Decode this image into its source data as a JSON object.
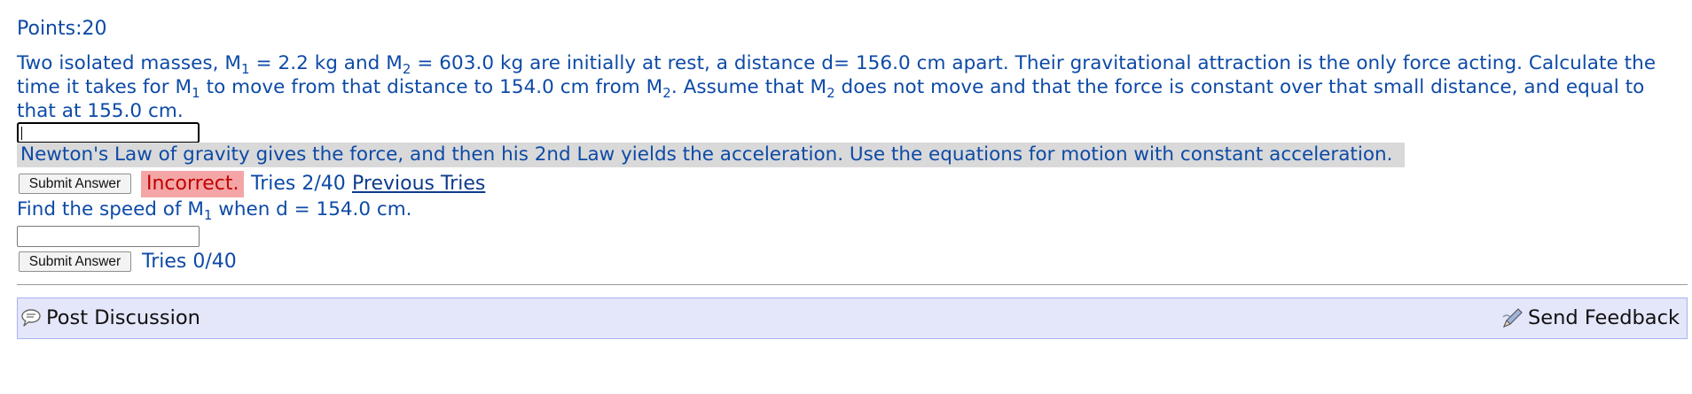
{
  "points": {
    "label": "Points:",
    "value": "20"
  },
  "problem": {
    "p1": "Two isolated masses, M",
    "s1": "1",
    "p2": " = 2.2 kg and M",
    "s2": "2",
    "p3": " = 603.0 kg are initially at rest, a distance d= 156.0 cm apart. Their gravitational attraction is the only force acting. Calculate the time it takes for M",
    "s3": "1",
    "p4": " to move from that distance to 154.0 cm from M",
    "s4": "2",
    "p5": ". Assume that M",
    "s5": "2",
    "p6": " does not move and that the force is constant over that small distance, and equal to that at 155.0 cm."
  },
  "answer1": {
    "value": ""
  },
  "hint": "Newton's Law of gravity gives the force, and then his 2nd Law yields the acceleration. Use the equations for motion with constant acceleration.",
  "attempt1": {
    "submit_label": "Submit Answer",
    "status": "Incorrect.",
    "tries": "Tries 2/40",
    "previous_tries": "Previous Tries"
  },
  "question2": {
    "p1": "Find the speed of M",
    "s1": "1",
    "p2": " when d = 154.0 cm."
  },
  "answer2": {
    "value": ""
  },
  "attempt2": {
    "submit_label": "Submit Answer",
    "tries": "Tries 0/40"
  },
  "footer": {
    "post_discussion": "Post Discussion",
    "send_feedback": "Send Feedback",
    "post_icon": "speech-bubble-icon",
    "feedback_icon": "pencil-feedback-icon"
  },
  "colors": {
    "text_blue": "#0d4aa6",
    "incorrect_bg": "#f4a6a6",
    "incorrect_text": "#c00000",
    "hint_bg": "#d9d9d9",
    "discussion_bg": "#e4e6fa"
  }
}
